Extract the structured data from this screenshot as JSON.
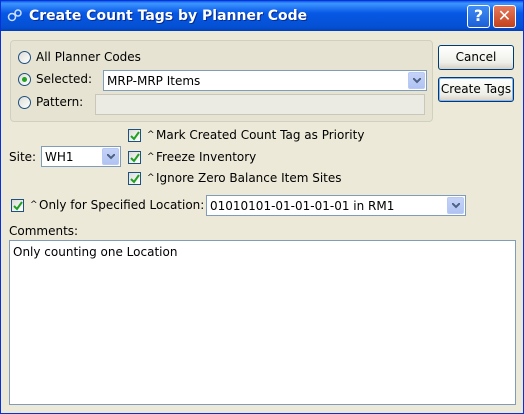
{
  "window": {
    "title": "Create Count Tags by Planner Code",
    "help_label": "?",
    "close_label": "✕"
  },
  "planner_codes": {
    "all_label": "All Planner Codes",
    "selected_label": "Selected:",
    "selected_value": "MRP-MRP Items",
    "pattern_label": "Pattern:",
    "pattern_value": "",
    "choice": "selected"
  },
  "buttons": {
    "cancel_label": "Cancel",
    "create_tags_label": "Create Tags"
  },
  "site": {
    "label": "Site:",
    "value": "WH1"
  },
  "options": {
    "priority_label": "Mark Created Count Tag as Priority",
    "priority_checked": true,
    "freeze_label": "Freeze Inventory",
    "freeze_checked": true,
    "ignore_zero_label": "Ignore Zero Balance Item Sites",
    "ignore_zero_checked": true,
    "location_label": "Only for Specified Location:",
    "location_checked": true,
    "location_value": "01010101-01-01-01-01 in RM1",
    "caret_glyph": "^"
  },
  "comments": {
    "label": "Comments:",
    "text": "Only counting one Location"
  }
}
